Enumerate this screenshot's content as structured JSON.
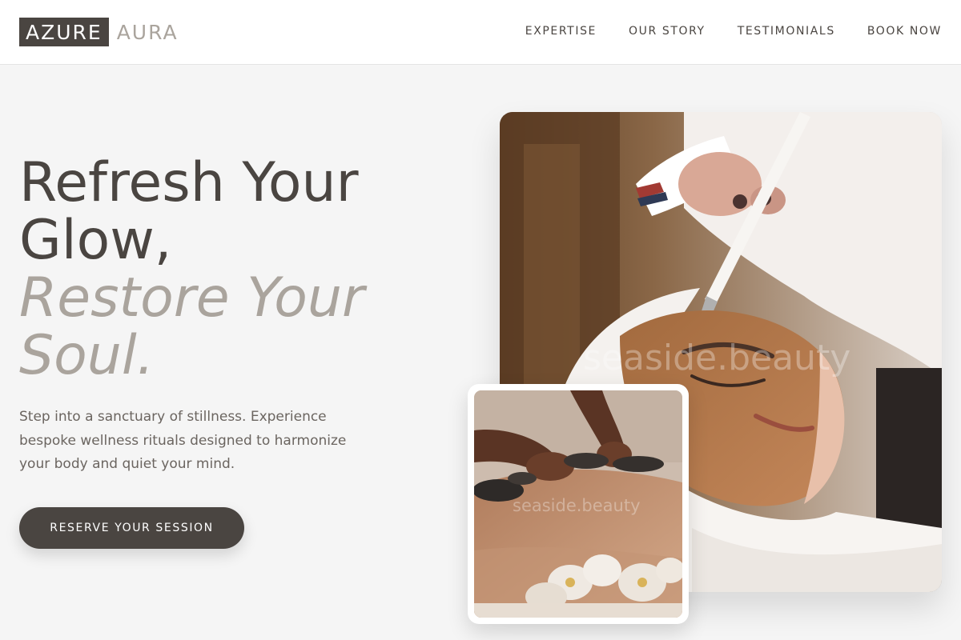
{
  "brand": {
    "logo_box": "AZURE",
    "logo_text": "AURA"
  },
  "nav": {
    "items": [
      "EXPERTISE",
      "OUR STORY",
      "TESTIMONIALS",
      "BOOK NOW"
    ]
  },
  "hero": {
    "headline_line1": "Refresh Your",
    "headline_line2": "Glow,",
    "headline_italic1": "Restore Your",
    "headline_italic2": "Soul.",
    "description": "Step into a sanctuary of stillness. Experience bespoke wellness rituals designed to harmonize your body and quiet your mind.",
    "cta_label": "RESERVE YOUR SESSION"
  },
  "images": {
    "main_watermark": "seaside.beauty",
    "secondary_watermark": "seaside.beauty"
  },
  "colors": {
    "primary_dark": "#4a4541",
    "accent_taupe": "#aaa49d",
    "background": "#f5f5f5",
    "header_background": "#ffffff"
  }
}
